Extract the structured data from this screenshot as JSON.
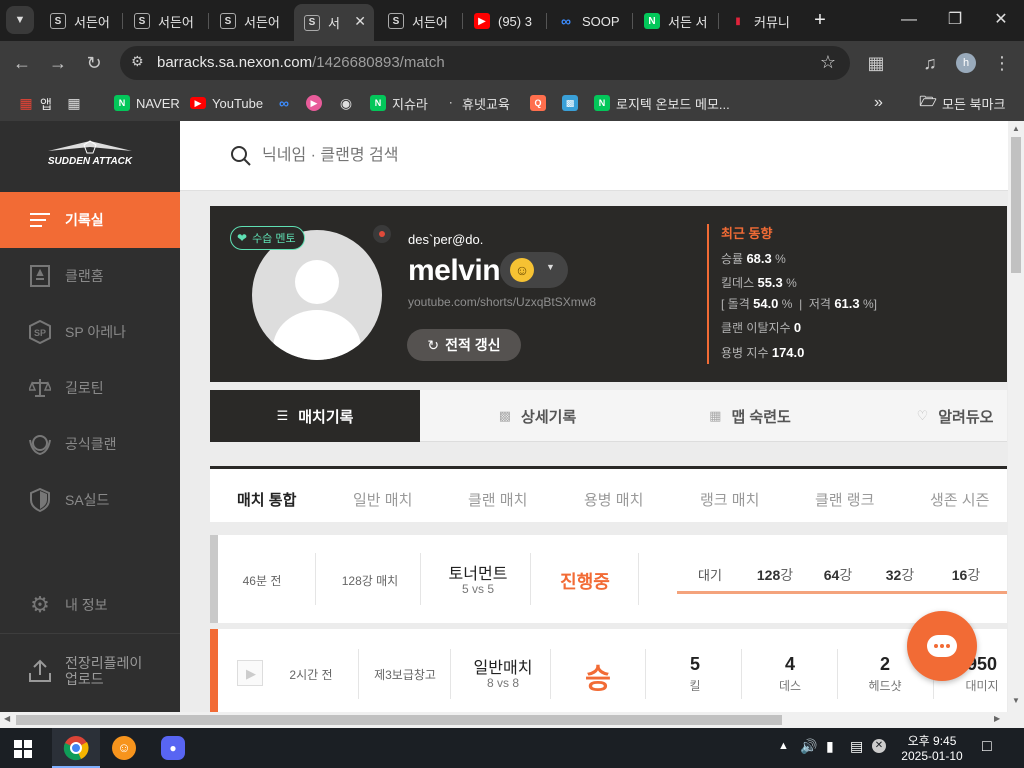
{
  "browser": {
    "tabs": [
      {
        "title": "서든어"
      },
      {
        "title": "서든어"
      },
      {
        "title": "서든어"
      },
      {
        "title": "서"
      },
      {
        "title": "서든어"
      },
      {
        "title": "(95) 3"
      },
      {
        "title": "SOOP"
      },
      {
        "title": "서든 서"
      },
      {
        "title": "커뮤니"
      }
    ],
    "url_host": "barracks.sa.nexon.com",
    "url_path": "/1426680893/match",
    "profile_initial": "h",
    "bookmarks": [
      {
        "label": "앱"
      },
      {
        "label": ""
      },
      {
        "label": "NAVER"
      },
      {
        "label": "YouTube"
      },
      {
        "label": ""
      },
      {
        "label": ""
      },
      {
        "label": ""
      },
      {
        "label": "지슈라"
      },
      {
        "label": "휴넷교육"
      },
      {
        "label": ""
      },
      {
        "label": ""
      },
      {
        "label": "로지텍 온보드 메모..."
      }
    ],
    "all_bookmarks": "모든 북마크"
  },
  "sidebar": {
    "logo": "SUDDEN ATTACK",
    "items": [
      {
        "label": "기록실",
        "icon": "list-icon"
      },
      {
        "label": "클랜홈",
        "icon": "clan-icon"
      },
      {
        "label": "SP 아레나",
        "icon": "sp-icon"
      },
      {
        "label": "길로틴",
        "icon": "scale-icon"
      },
      {
        "label": "공식클랜",
        "icon": "badge-icon"
      },
      {
        "label": "SA실드",
        "icon": "shield-icon"
      }
    ],
    "my_info": "내 정보",
    "upload": "전장리플레이\n업로드"
  },
  "search": {
    "placeholder": "닉네임 · 클랜명 검색"
  },
  "profile": {
    "badge": "수습 멘토",
    "clan": "des`per@do.",
    "name": "melvin",
    "link": "youtube.com/shorts/UzxqBtSXmw8",
    "refresh": "전적 갱신",
    "recent_title": "최근 동향",
    "win_rate_label": "승률",
    "win_rate": "68.3",
    "kd_label": "킬데스",
    "kd": "55.3",
    "assault_label": "돌격",
    "assault": "54.0",
    "sniper_label": "저격",
    "sniper": "61.3",
    "clan_leave_label": "클랜 이탈지수",
    "clan_leave": "0",
    "merc_label": "용병 지수",
    "merc": "174.0",
    "pct": "%"
  },
  "main_tabs": [
    {
      "label": "매치기록"
    },
    {
      "label": "상세기록"
    },
    {
      "label": "맵 숙련도"
    },
    {
      "label": "알려듀오"
    }
  ],
  "sub_tabs": [
    {
      "label": "매치 통합"
    },
    {
      "label": "일반 매치"
    },
    {
      "label": "클랜 매치"
    },
    {
      "label": "용병 매치"
    },
    {
      "label": "랭크 매치"
    },
    {
      "label": "클랜 랭크"
    },
    {
      "label": "생존 시즌"
    }
  ],
  "tournament_row": {
    "time": "46분 전",
    "type": "128강 매치",
    "mode": "토너먼트",
    "mode_sub": "5 vs 5",
    "status": "진행중",
    "bracket": [
      {
        "label": "대기"
      },
      {
        "label": "128",
        "unit": "강"
      },
      {
        "label": "64",
        "unit": "강"
      },
      {
        "label": "32",
        "unit": "강"
      },
      {
        "label": "16",
        "unit": "강"
      }
    ]
  },
  "match_row": {
    "time": "2시간 전",
    "map": "제3보급창고",
    "mode": "일반매치",
    "mode_sub": "8 vs 8",
    "result": "승",
    "kills": "5",
    "kills_label": "킬",
    "deaths": "4",
    "deaths_label": "데스",
    "headshots": "2",
    "headshots_label": "헤드샷",
    "damage": "950",
    "damage_label": "대미지"
  },
  "taskbar": {
    "time": "오후 9:45",
    "date": "2025-01-10"
  },
  "colors": {
    "accent": "#f26b35",
    "sidebar": "#2f2f2f",
    "profile_bg": "#2a2927",
    "mint": "#5fe0b4"
  }
}
